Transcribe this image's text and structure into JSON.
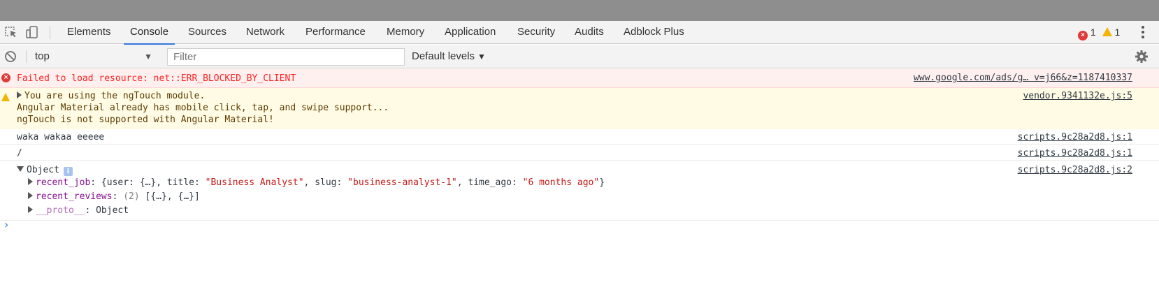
{
  "toolbar": {
    "tabs": [
      {
        "label": "Elements"
      },
      {
        "label": "Console"
      },
      {
        "label": "Sources"
      },
      {
        "label": "Network"
      },
      {
        "label": "Performance"
      },
      {
        "label": "Memory"
      },
      {
        "label": "Application"
      },
      {
        "label": "Security"
      },
      {
        "label": "Audits"
      },
      {
        "label": "Adblock Plus"
      }
    ],
    "active_tab": "Console",
    "error_count": "1",
    "warning_count": "1"
  },
  "filterbar": {
    "context": "top",
    "filter_placeholder": "Filter",
    "levels_label": "Default levels"
  },
  "console": {
    "error": {
      "text": "Failed to load resource: net::ERR_BLOCKED_BY_CLIENT",
      "source": "www.google.com/ads/g… v=j66&z=1187410337"
    },
    "warning": {
      "line1": "You are using the ngTouch module.",
      "line2": "Angular Material already has mobile click, tap, and swipe support...",
      "line3": "ngTouch is not supported with Angular Material!",
      "source": "vendor.9341132e.js:5"
    },
    "log1": {
      "text": "waka wakaa eeeee",
      "source": "scripts.9c28a2d8.js:1"
    },
    "log2": {
      "text": "/",
      "source": "scripts.9c28a2d8.js:1"
    },
    "object": {
      "label": "Object",
      "info": "i",
      "source": "scripts.9c28a2d8.js:2",
      "recent_job": {
        "key": "recent_job",
        "p1": ": {user: {…}, title: ",
        "title": "\"Business Analyst\"",
        "p2": ", slug: ",
        "slug": "\"business-analyst-1\"",
        "p3": ", time_ago: ",
        "time_ago": "\"6 months ago\"",
        "p4": "}"
      },
      "recent_reviews": {
        "key": "recent_reviews",
        "count": "(2)",
        "value": "[{…}, {…}]"
      },
      "proto": {
        "key": "__proto__",
        "value": "Object"
      }
    },
    "prompt": "›"
  },
  "colors": {
    "accent": "#3879d9",
    "error_bg": "#fff0f0",
    "error_text": "#fe2222",
    "warning_bg": "#fffbe5",
    "warning_text": "#5c3c00"
  },
  "icons": {
    "inspect": "inspect-element-icon",
    "device": "device-toolbar-icon",
    "clear": "clear-console-icon",
    "settings": "gear-icon",
    "menu": "kebab-menu-icon"
  }
}
